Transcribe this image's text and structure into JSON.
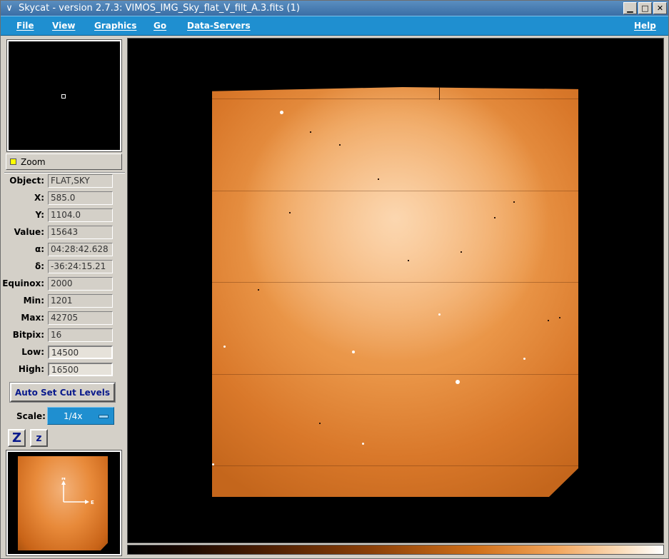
{
  "window": {
    "title": "Skycat - version 2.7.3: VIMOS_IMG_Sky_flat_V_filt_A.3.fits (1)"
  },
  "menu": {
    "items": [
      "File",
      "View",
      "Graphics",
      "Go",
      "Data-Servers"
    ],
    "help": "Help"
  },
  "zoom": {
    "label": "Zoom"
  },
  "info": {
    "object_label": "Object:",
    "object": "FLAT,SKY",
    "x_label": "X:",
    "x": "585.0",
    "y_label": "Y:",
    "y": "1104.0",
    "value_label": "Value:",
    "value": "15643",
    "alpha_label": "α:",
    "alpha": "04:28:42.628",
    "delta_label": "δ:",
    "delta": "-36:24:15.21",
    "equinox_label": "Equinox:",
    "equinox": "2000",
    "min_label": "Min:",
    "min": "1201",
    "max_label": "Max:",
    "max": "42705",
    "bitpix_label": "Bitpix:",
    "bitpix": "16",
    "low_label": "Low:",
    "low": "14500",
    "high_label": "High:",
    "high": "16500"
  },
  "controls": {
    "auto_cut": "Auto Set Cut Levels",
    "scale_label": "Scale:",
    "scale_value": "1/4x",
    "zoom_in": "Z",
    "zoom_out": "z"
  },
  "compass": {
    "north": "N",
    "east": "E"
  },
  "colors": {
    "menubar": "#1f8fd0",
    "image_orange": "#ea9648",
    "titlebar": "#3a6ea5"
  }
}
